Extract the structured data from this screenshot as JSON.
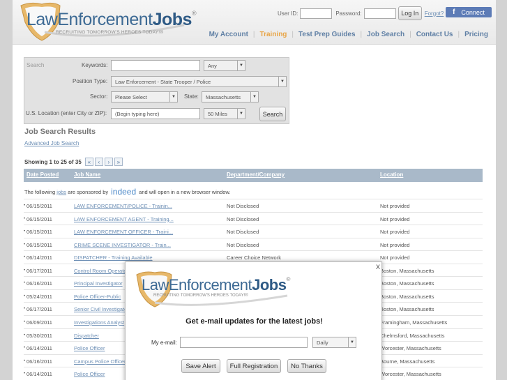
{
  "brand": {
    "name_part1": "LawEnforcement",
    "name_part2": "Jobs",
    "reg": "®",
    "tagline": "RECRUITING TOMORROW'S HEROES TODAY!®"
  },
  "login": {
    "user_id_label": "User ID:",
    "password_label": "Password:",
    "login_button": "Log In",
    "forgot_link": "Forgot?",
    "facebook_button": "Connect"
  },
  "nav": {
    "items": [
      "My Account",
      "Training",
      "Test Prep Guides",
      "Job Search",
      "Contact Us",
      "Pricing"
    ],
    "active_index": 1
  },
  "search": {
    "search_label": "Search",
    "keywords_label": "Keywords:",
    "keywords_value": "",
    "any_select": "Any",
    "position_label": "Position Type:",
    "position_value": "Law Enforcement - State Trooper / Police",
    "sector_label": "Sector:",
    "sector_value": "Please Select",
    "state_label": "State:",
    "state_value": "Massachusetts",
    "location_label": "U.S. Location (enter City or ZIP):",
    "location_placeholder": "(Begin typing here)",
    "radius_value": "50 Miles",
    "search_button": "Search"
  },
  "results": {
    "title": "Job Search Results",
    "advanced_link": "Advanced Job Search",
    "showing_text": "Showing 1 to 25 of 35",
    "columns": [
      "Date Posted",
      "Job Name",
      "Department/Company",
      "Location"
    ],
    "sponsor_prefix": "The following",
    "sponsor_link": "jobs",
    "sponsor_mid": "are sponsored by",
    "sponsor_brand": "indeed",
    "sponsor_suffix": "and will open in a new browser window.",
    "rows": [
      {
        "date": "06/15/2011",
        "job": "LAW ENFORCEMENT/POLICE - Trainin...",
        "dept": "Not Disclosed",
        "loc": "Not provided"
      },
      {
        "date": "06/15/2011",
        "job": "LAW ENFORCEMENT AGENT - Training...",
        "dept": "Not Disclosed",
        "loc": "Not provided"
      },
      {
        "date": "06/15/2011",
        "job": "LAW ENFORCEMENT OFFICER - Traini...",
        "dept": "Not Disclosed",
        "loc": "Not provided"
      },
      {
        "date": "06/15/2011",
        "job": "CRIME SCENE INVESTIGATOR - Train...",
        "dept": "Not Disclosed",
        "loc": "Not provided"
      },
      {
        "date": "06/14/2011",
        "job": "DISPATCHER - Training Available",
        "dept": "Career Choice Network",
        "loc": "Not provided"
      },
      {
        "date": "06/17/2011",
        "job": "Control Room Operator",
        "dept": "",
        "loc": "Boston, Massachusetts"
      },
      {
        "date": "06/16/2011",
        "job": "Principal Investigator",
        "dept": "",
        "loc": "Boston, Massachusetts"
      },
      {
        "date": "05/24/2011",
        "job": "Police Officer-Public",
        "dept": "",
        "loc": "Boston, Massachusetts"
      },
      {
        "date": "06/17/2011",
        "job": "Senior Civil Investigator",
        "dept": "",
        "loc": "Boston, Massachusetts"
      },
      {
        "date": "06/09/2011",
        "job": "Investigations Analyst",
        "dept": "",
        "loc": "Framingham, Massachusetts"
      },
      {
        "date": "05/30/2011",
        "job": "Dispatcher",
        "dept": "",
        "loc": "Chelmsford, Massachusetts"
      },
      {
        "date": "06/14/2011",
        "job": "Police Officer",
        "dept": "",
        "loc": "Worcester, Massachusetts"
      },
      {
        "date": "06/16/2011",
        "job": "Campus Police Officer",
        "dept": "",
        "loc": "Bourne, Massachusetts"
      },
      {
        "date": "06/14/2011",
        "job": "Police Officer",
        "dept": "",
        "loc": "Worcester, Massachusetts"
      }
    ]
  },
  "modal": {
    "close": "X",
    "headline": "Get e-mail updates for the latest jobs!",
    "email_label": "My e-mail:",
    "email_value": "",
    "frequency_value": "Daily",
    "save_alert_button": "Save Alert",
    "full_registration_button": "Full Registration",
    "no_thanks_button": "No Thanks"
  },
  "colors": {
    "brand_blue": "#3d6a94",
    "nav_link": "#6080a5",
    "nav_active": "#e8a547",
    "table_header": "#a9b9c9",
    "facebook": "#5c7bb6"
  }
}
